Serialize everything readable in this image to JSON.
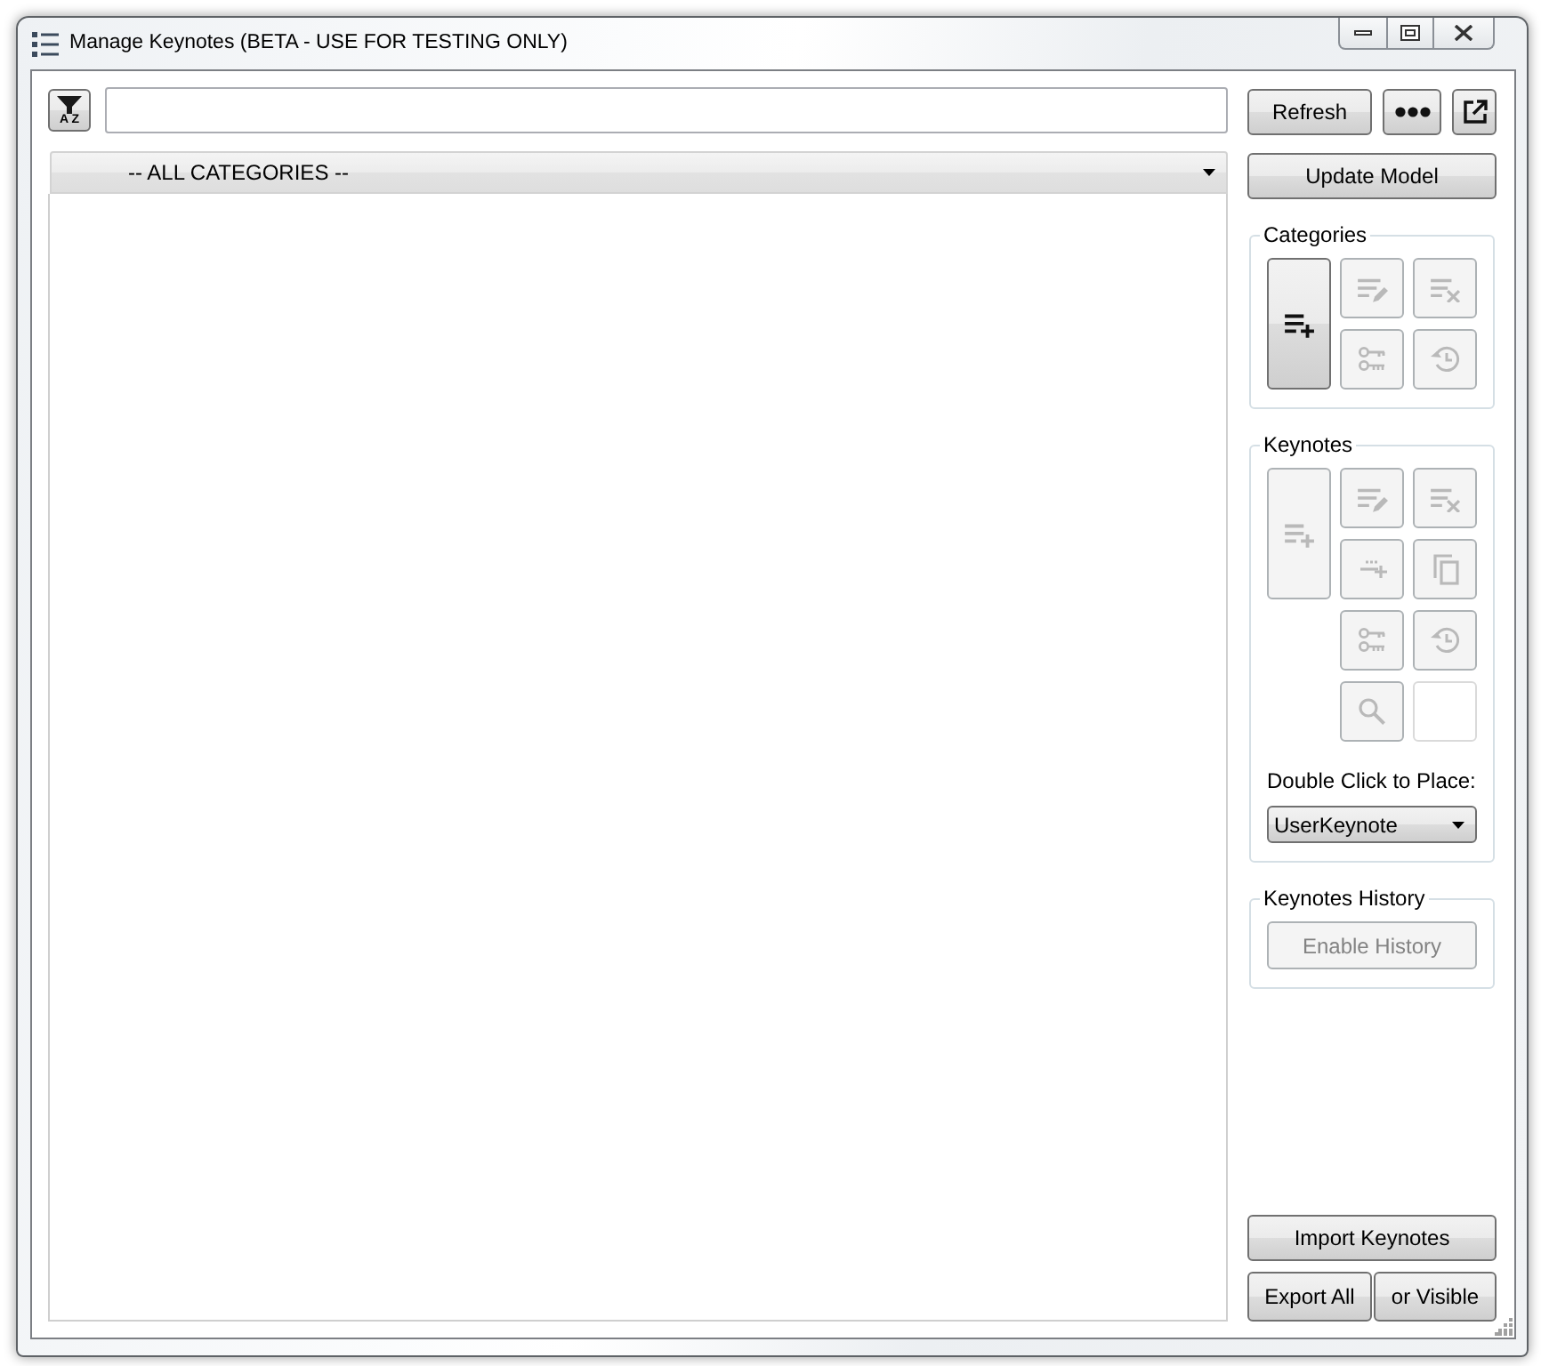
{
  "window": {
    "title": "Manage Keynotes (BETA - USE FOR TESTING ONLY)",
    "controls": [
      {
        "kind": "minimize"
      },
      {
        "kind": "maximize"
      },
      {
        "kind": "close"
      }
    ]
  },
  "sort_button": {
    "letters": "A Z"
  },
  "toolbar_buttons": [
    {
      "kind": "text",
      "label": "Refresh"
    },
    {
      "kind": "more"
    },
    {
      "kind": "popout"
    }
  ],
  "category_filter": {
    "value": "-- ALL CATEGORIES --"
  },
  "update_button": {
    "label": "Update Model"
  },
  "categories": {
    "title": "Categories",
    "buttons": [
      {
        "kind": "add",
        "disabled": false
      },
      {
        "kind": "edit",
        "disabled": true
      },
      {
        "kind": "remove",
        "disabled": true
      },
      {
        "kind": "key",
        "disabled": true
      },
      {
        "kind": "history",
        "disabled": true
      }
    ]
  },
  "keynotes": {
    "title": "Keynotes",
    "buttons": [
      {
        "kind": "add",
        "disabled": true
      },
      {
        "kind": "edit",
        "disabled": true
      },
      {
        "kind": "remove",
        "disabled": true
      },
      {
        "kind": "add_child",
        "disabled": true
      },
      {
        "kind": "copy",
        "disabled": true
      },
      {
        "kind": "key",
        "disabled": true
      },
      {
        "kind": "history",
        "disabled": true
      },
      {
        "kind": "search",
        "disabled": true
      },
      {
        "kind": "blank",
        "disabled": true
      }
    ],
    "place_label": "Double Click to Place:",
    "place_type": {
      "value": "UserKeynote"
    }
  },
  "history": {
    "title": "Keynotes History",
    "button": {
      "label": "Enable History",
      "disabled": true
    }
  },
  "import_button": {
    "label": "Import Keynotes"
  },
  "export_buttons": [
    {
      "label": "Export All"
    },
    {
      "label": "or Visible"
    }
  ]
}
